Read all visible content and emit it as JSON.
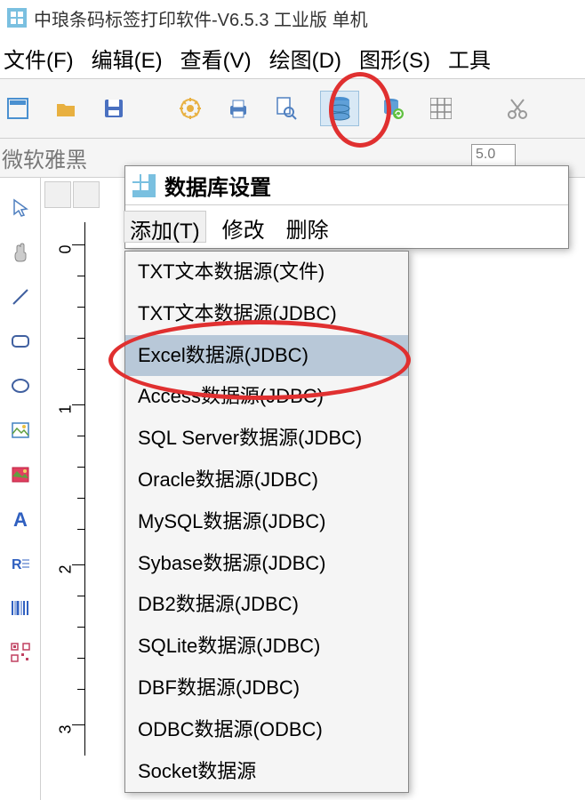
{
  "window": {
    "title": "中琅条码标签打印软件-V6.5.3 工业版 单机"
  },
  "menu": {
    "file": "文件(F)",
    "edit": "编辑(E)",
    "view": "查看(V)",
    "draw": "绘图(D)",
    "shape": "图形(S)",
    "tool": "工具"
  },
  "toolbar": {
    "icons": [
      "new-doc-icon",
      "open-icon",
      "save-icon",
      "settings-icon",
      "print-icon",
      "preview-icon",
      "database-icon",
      "db-refresh-icon",
      "grid-icon",
      "cut-icon"
    ]
  },
  "font": {
    "name": "微软雅黑",
    "size": "5.0"
  },
  "left_tools": {
    "icons": [
      "cursor-icon",
      "hand-icon",
      "line-icon",
      "rect-icon",
      "circle-icon",
      "image-icon",
      "photo-icon",
      "text-icon",
      "richtext-icon",
      "barcode-icon",
      "qrcode-icon"
    ]
  },
  "dialog": {
    "title": "数据库设置",
    "menu": {
      "add": "添加(T)",
      "modify": "修改",
      "delete": "删除"
    }
  },
  "dropdown": {
    "items": [
      "TXT文本数据源(文件)",
      "TXT文本数据源(JDBC)",
      "Excel数据源(JDBC)",
      "Access数据源(JDBC)",
      "SQL Server数据源(JDBC)",
      "Oracle数据源(JDBC)",
      "MySQL数据源(JDBC)",
      "Sybase数据源(JDBC)",
      "DB2数据源(JDBC)",
      "SQLite数据源(JDBC)",
      "DBF数据源(JDBC)",
      "ODBC数据源(ODBC)",
      "Socket数据源"
    ],
    "selected_index": 2
  },
  "ruler": {
    "marks": [
      "0",
      "1",
      "2",
      "3"
    ]
  }
}
